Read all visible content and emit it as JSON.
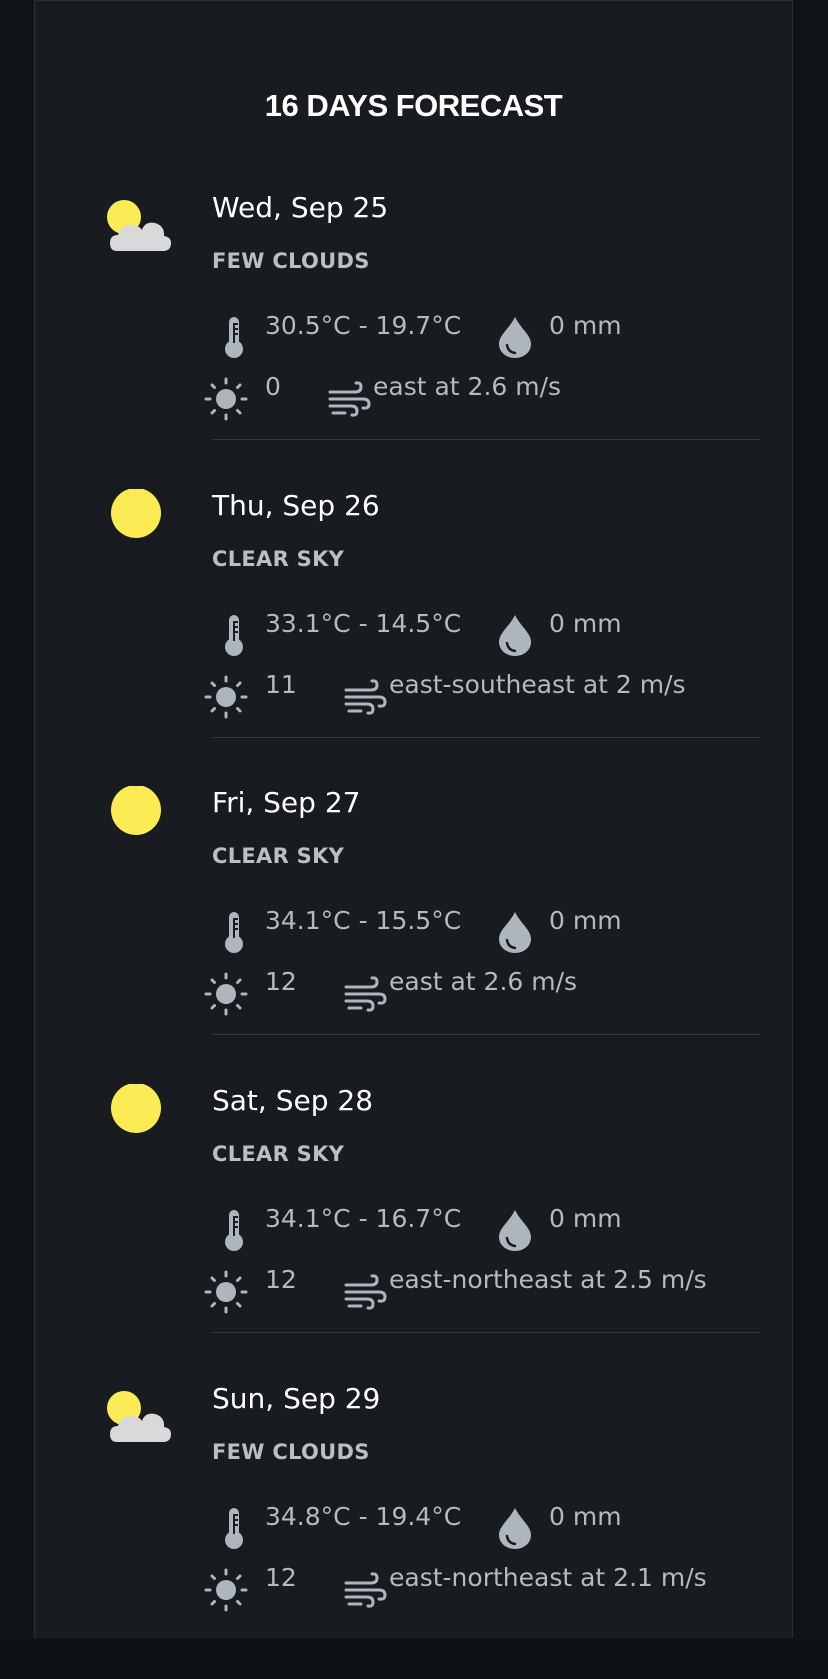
{
  "title": "16 DAYS FORECAST",
  "days": [
    {
      "date": "Wed, Sep 25",
      "description": "FEW CLOUDS",
      "icon": "few-clouds-icon",
      "temp": "30.5°C - 19.7°C",
      "precip": "0 mm",
      "uv": "0",
      "wind": "east at 2.6 m/s"
    },
    {
      "date": "Thu, Sep 26",
      "description": "CLEAR SKY",
      "icon": "clear-sky-icon",
      "temp": "33.1°C - 14.5°C",
      "precip": "0 mm",
      "uv": "11",
      "wind": "east-southeast at 2 m/s"
    },
    {
      "date": "Fri, Sep 27",
      "description": "CLEAR SKY",
      "icon": "clear-sky-icon",
      "temp": "34.1°C - 15.5°C",
      "precip": "0 mm",
      "uv": "12",
      "wind": "east at 2.6 m/s"
    },
    {
      "date": "Sat, Sep 28",
      "description": "CLEAR SKY",
      "icon": "clear-sky-icon",
      "temp": "34.1°C - 16.7°C",
      "precip": "0 mm",
      "uv": "12",
      "wind": "east-northeast at 2.5 m/s"
    },
    {
      "date": "Sun, Sep 29",
      "description": "FEW CLOUDS",
      "icon": "few-clouds-icon",
      "temp": "34.8°C - 19.4°C",
      "precip": "0 mm",
      "uv": "12",
      "wind": "east-northeast at 2.1 m/s"
    }
  ],
  "colors": {
    "background": "#181b1f",
    "text_primary": "#ffffff",
    "text_secondary": "#b4babf",
    "sun": "#fbec55",
    "cloud": "#d9d9d9",
    "metric_icon": "#aeb6bd"
  }
}
